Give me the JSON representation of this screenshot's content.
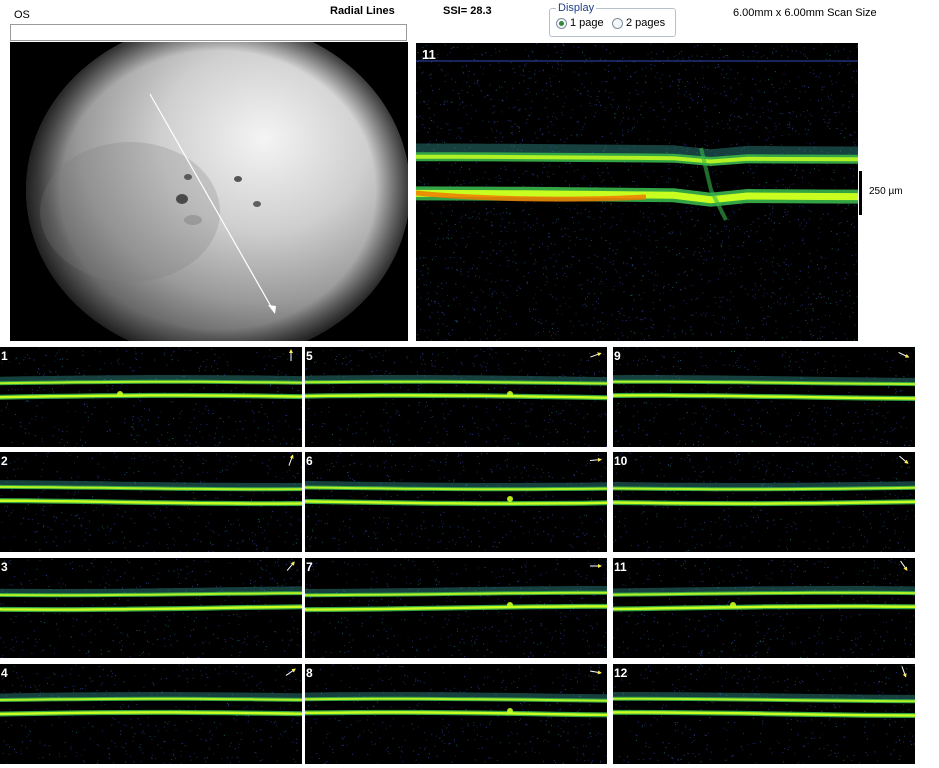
{
  "header": {
    "eye": "OS",
    "scan_type": "Radial Lines",
    "ssi": "SSI= 28.3",
    "scan_size": "6.00mm x 6.00mm Scan Size"
  },
  "display": {
    "legend": "Display",
    "options": [
      {
        "label": "1 page",
        "selected": true
      },
      {
        "label": "2 pages",
        "selected": false
      }
    ]
  },
  "main_scan": {
    "number": "11",
    "scale_label": "250 µm"
  },
  "thumbnails": [
    {
      "number": "1",
      "direction_icon": "arrow-up-icon",
      "angle": -90
    },
    {
      "number": "5",
      "direction_icon": "arrow-up-right-icon",
      "angle": -20
    },
    {
      "number": "9",
      "direction_icon": "arrow-down-right-icon",
      "angle": 25
    },
    {
      "number": "2",
      "direction_icon": "arrow-up-right-icon",
      "angle": -70
    },
    {
      "number": "6",
      "direction_icon": "arrow-right-icon",
      "angle": -5
    },
    {
      "number": "10",
      "direction_icon": "arrow-down-right-icon",
      "angle": 40
    },
    {
      "number": "3",
      "direction_icon": "arrow-up-right-icon",
      "angle": -50
    },
    {
      "number": "7",
      "direction_icon": "arrow-right-icon",
      "angle": 0
    },
    {
      "number": "11",
      "direction_icon": "arrow-down-right-icon",
      "angle": 55
    },
    {
      "number": "4",
      "direction_icon": "arrow-up-right-icon",
      "angle": -35
    },
    {
      "number": "8",
      "direction_icon": "arrow-right-icon",
      "angle": 10
    },
    {
      "number": "12",
      "direction_icon": "arrow-down-right-icon",
      "angle": 70
    }
  ],
  "colors": {
    "retina_bright": "#c8ff20",
    "retina_mid": "#39b54a",
    "retina_hot": "#f07a00",
    "noise": "#2a3f9a",
    "background": "#000000"
  }
}
